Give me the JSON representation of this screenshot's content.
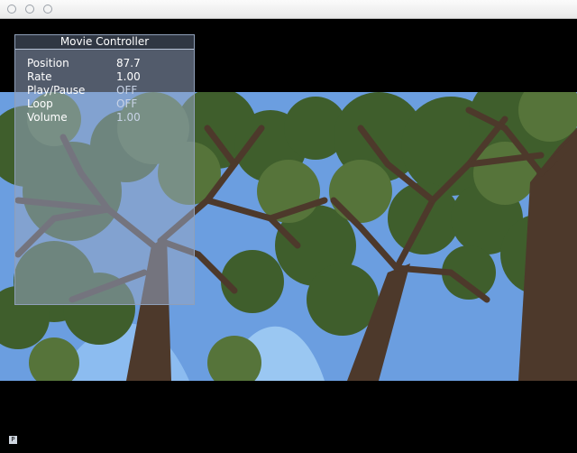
{
  "window": {
    "buttons": [
      "close",
      "minimize",
      "zoom"
    ]
  },
  "controller": {
    "title": "Movie  Controller",
    "rows": [
      {
        "label": "Position",
        "value": "87.7"
      },
      {
        "label": "Rate",
        "value": "1.00"
      },
      {
        "label": "Play/Pause",
        "value": "OFF"
      },
      {
        "label": "Loop",
        "value": "OFF"
      },
      {
        "label": "Volume",
        "value": "1.00"
      }
    ]
  },
  "status": {
    "icon_letter": "P"
  },
  "colors": {
    "sky": "#6a9fe0",
    "foliage": "#4e6b34",
    "trunk": "#4e3a2c",
    "background": "#000000"
  }
}
